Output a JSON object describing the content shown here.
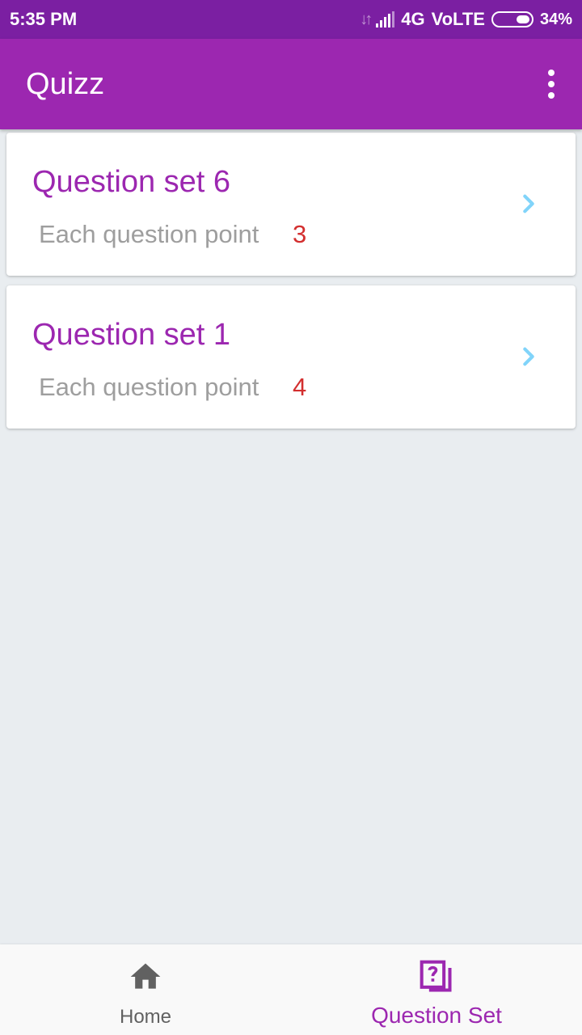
{
  "status_bar": {
    "time": "5:35 PM",
    "network": "4G",
    "volte": "VoLTE",
    "battery": "34%"
  },
  "app_bar": {
    "title": "Quizz",
    "menu_icon": "more-vert-icon"
  },
  "question_sets": [
    {
      "title": "Question set 6",
      "label": "Each question point",
      "points": "3"
    },
    {
      "title": "Question set 1",
      "label": "Each question point",
      "points": "4"
    }
  ],
  "bottom_nav": {
    "items": [
      {
        "label": "Home",
        "icon": "home-icon",
        "active": false
      },
      {
        "label": "Question Set",
        "icon": "question-set-icon",
        "active": true
      }
    ]
  },
  "colors": {
    "primary": "#9c27b0",
    "primary_dark": "#7b1fa2",
    "points": "#d32f2f",
    "chevron": "#81d4fa",
    "background": "#e9edf0"
  }
}
